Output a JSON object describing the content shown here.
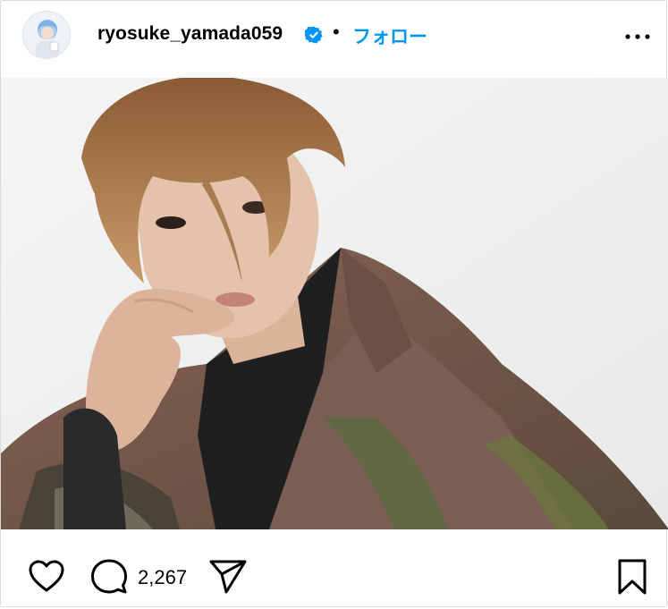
{
  "header": {
    "username": "ryosuke_yamada059",
    "separator": "•",
    "follow_label": "フォロー"
  },
  "post": {
    "comment_count": "2,267"
  },
  "colors": {
    "link_blue": "#0095f6",
    "verified_blue": "#0095f6",
    "border": "#dbdbdb"
  },
  "icons": [
    "verified-badge-icon",
    "more-options-icon",
    "like-heart-icon",
    "comment-bubble-icon",
    "share-send-icon",
    "save-bookmark-icon"
  ]
}
